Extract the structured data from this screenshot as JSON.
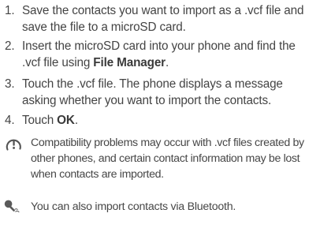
{
  "steps": [
    {
      "number": "1.",
      "text": "Save the contacts you want to import as a .vcf file and save the file to a microSD card."
    },
    {
      "number": "2.",
      "text_before": "Insert the microSD card into your phone and find the .vcf file using ",
      "bold": "File Manager",
      "text_after": "."
    },
    {
      "number": "3.",
      "text": "Touch the .vcf file. The phone displays a message asking whether you want to import the contacts."
    },
    {
      "number": "4.",
      "text_before": "Touch ",
      "bold": "OK",
      "text_after": "."
    }
  ],
  "note": {
    "icon": "caution-icon",
    "text": "Compatibility problems may occur with .vcf files created by other phones, and certain contact information may be lost when contacts are imported."
  },
  "tip": {
    "icon": "tip-icon",
    "text": "You can also import contacts via Bluetooth."
  },
  "colors": {
    "text": "#444444",
    "icon": "#555555"
  }
}
